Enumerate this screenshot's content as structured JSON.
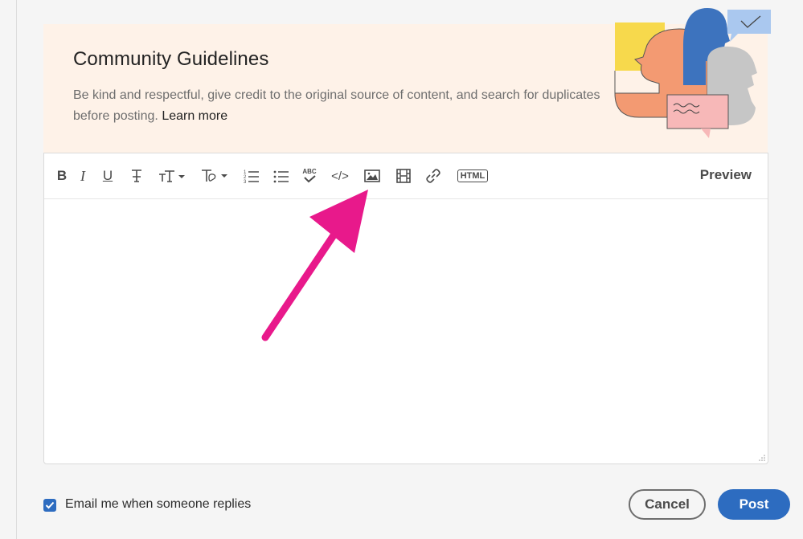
{
  "guidelines": {
    "title": "Community Guidelines",
    "body": "Be kind and respectful, give credit to the original source of content, and search for duplicates before posting.",
    "link": "Learn more"
  },
  "toolbar": {
    "buttons": [
      {
        "name": "bold",
        "icon": "bold-icon",
        "glyph": "B"
      },
      {
        "name": "italic",
        "icon": "italic-icon",
        "glyph": "I"
      },
      {
        "name": "underline",
        "icon": "underline-icon",
        "glyph": "U"
      },
      {
        "name": "strikethrough",
        "icon": "strikethrough-icon"
      },
      {
        "name": "text-size",
        "icon": "text-size-icon"
      },
      {
        "name": "text-style",
        "icon": "text-style-icon"
      },
      {
        "name": "numbered-list",
        "icon": "numbered-list-icon"
      },
      {
        "name": "bulleted-list",
        "icon": "bulleted-list-icon"
      },
      {
        "name": "spell-check",
        "icon": "spellcheck-icon",
        "glyph": "ABC"
      },
      {
        "name": "code",
        "icon": "code-icon",
        "glyph": "</>"
      },
      {
        "name": "insert-image",
        "icon": "image-icon"
      },
      {
        "name": "insert-video",
        "icon": "video-icon"
      },
      {
        "name": "insert-link",
        "icon": "link-icon"
      },
      {
        "name": "html",
        "icon": "html-icon",
        "glyph": "HTML"
      }
    ],
    "preview_label": "Preview"
  },
  "editor": {
    "content": ""
  },
  "footer": {
    "email_checkbox_checked": true,
    "email_label": "Email me when someone replies",
    "cancel_label": "Cancel",
    "post_label": "Post"
  },
  "colors": {
    "accent": "#2d6cc0",
    "banner_bg": "#fef2e8",
    "annotation_arrow": "#e8198b"
  }
}
